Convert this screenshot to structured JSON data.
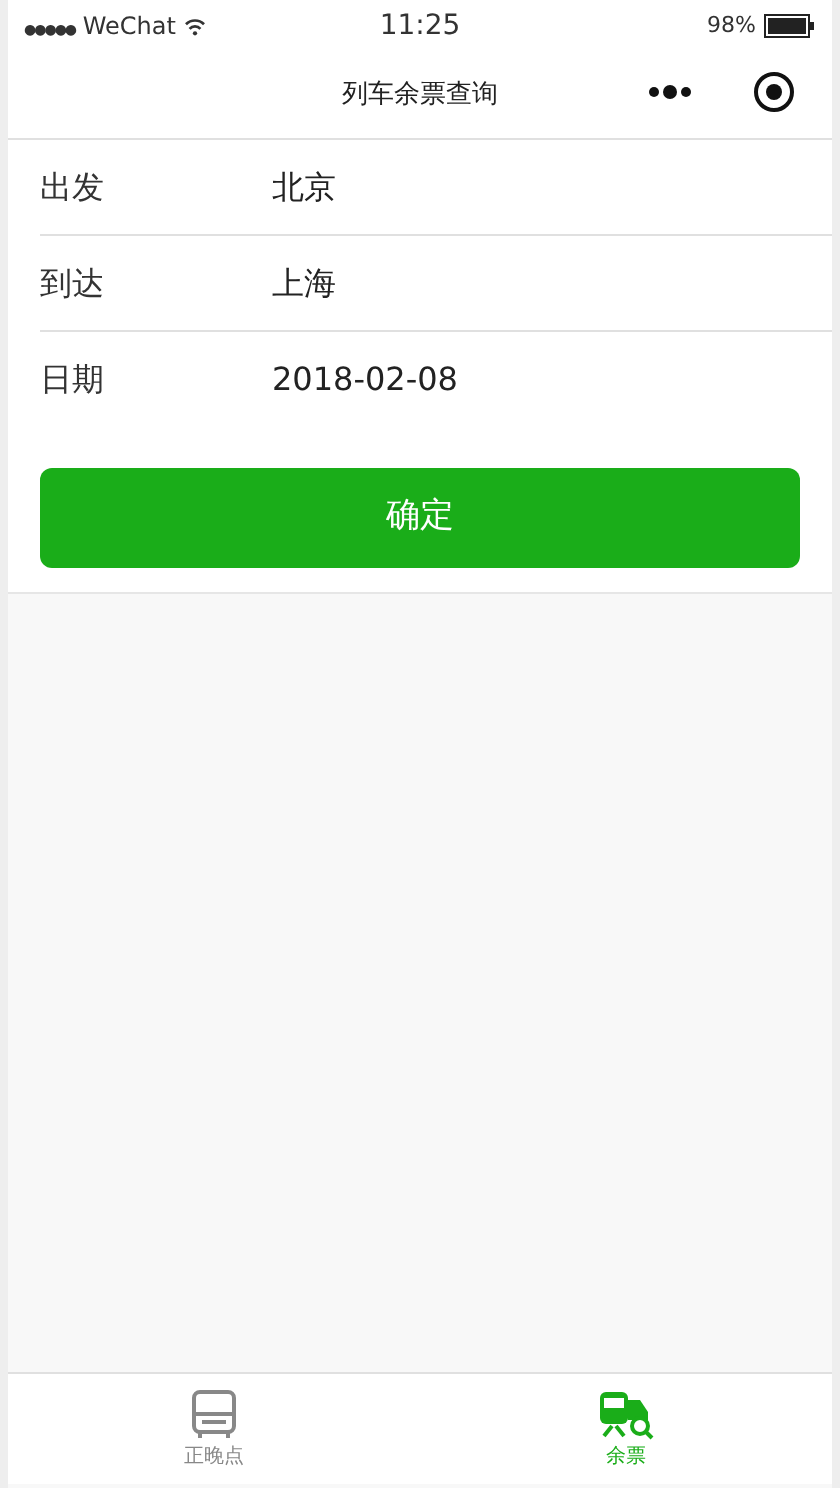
{
  "status_bar": {
    "carrier": "●●●●● WeChat",
    "time": "11:25",
    "battery": "98%"
  },
  "nav": {
    "title": "列车余票查询"
  },
  "form": [
    {
      "label": "出发",
      "value": "北京"
    },
    {
      "label": "到达",
      "value": "上海"
    },
    {
      "label": "日期",
      "value": "2018-02-08"
    }
  ],
  "submit": "确定",
  "tab_bar": [
    {
      "label": "正晚点",
      "kind": "bus",
      "selected": false
    },
    {
      "label": "余票",
      "kind": "train",
      "selected": true
    }
  ]
}
